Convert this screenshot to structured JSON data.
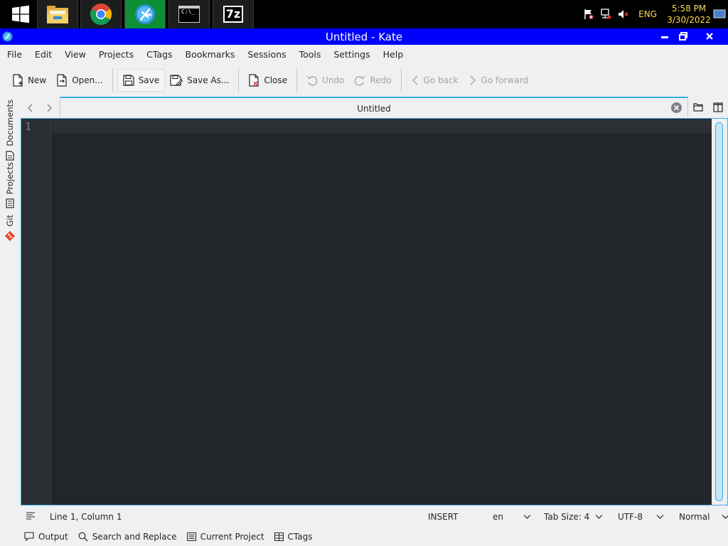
{
  "taskbar": {
    "apps": [
      {
        "name": "start",
        "icon": "windows-logo-icon"
      },
      {
        "name": "file-explorer",
        "icon": "folder-icon"
      },
      {
        "name": "chrome",
        "icon": "chrome-icon"
      },
      {
        "name": "kate",
        "icon": "kate-icon"
      },
      {
        "name": "terminal",
        "icon": "terminal-icon",
        "label": "C:\\_"
      },
      {
        "name": "7zip",
        "icon": "7zip-icon",
        "label": "7z"
      }
    ],
    "tray": {
      "lang": "ENG",
      "time": "5:58 PM",
      "date": "3/30/2022"
    }
  },
  "window": {
    "title": "Untitled  - Kate",
    "colors": {
      "titlebar": "#0000ff",
      "accent": "#3daee9",
      "editor_bg": "#232629"
    }
  },
  "menu": [
    "File",
    "Edit",
    "View",
    "Projects",
    "CTags",
    "Bookmarks",
    "Sessions",
    "Tools",
    "Settings",
    "Help"
  ],
  "toolbar": {
    "new": "New",
    "open": "Open...",
    "save": "Save",
    "save_as": "Save As...",
    "close": "Close",
    "undo": "Undo",
    "redo": "Redo",
    "go_back": "Go back",
    "go_forward": "Go forward"
  },
  "sidebar": {
    "documents": "Documents",
    "projects": "Projects",
    "git": "Git"
  },
  "tabs": {
    "active": "Untitled"
  },
  "editor": {
    "line_number": "1"
  },
  "status": {
    "position": "Line 1, Column 1",
    "mode": "INSERT",
    "language": "en",
    "tab_size": "Tab Size: 4",
    "encoding": "UTF-8",
    "highlight": "Normal"
  },
  "bottom_panel": {
    "output": "Output",
    "search": "Search and Replace",
    "current_project": "Current Project",
    "ctags": "CTags"
  }
}
